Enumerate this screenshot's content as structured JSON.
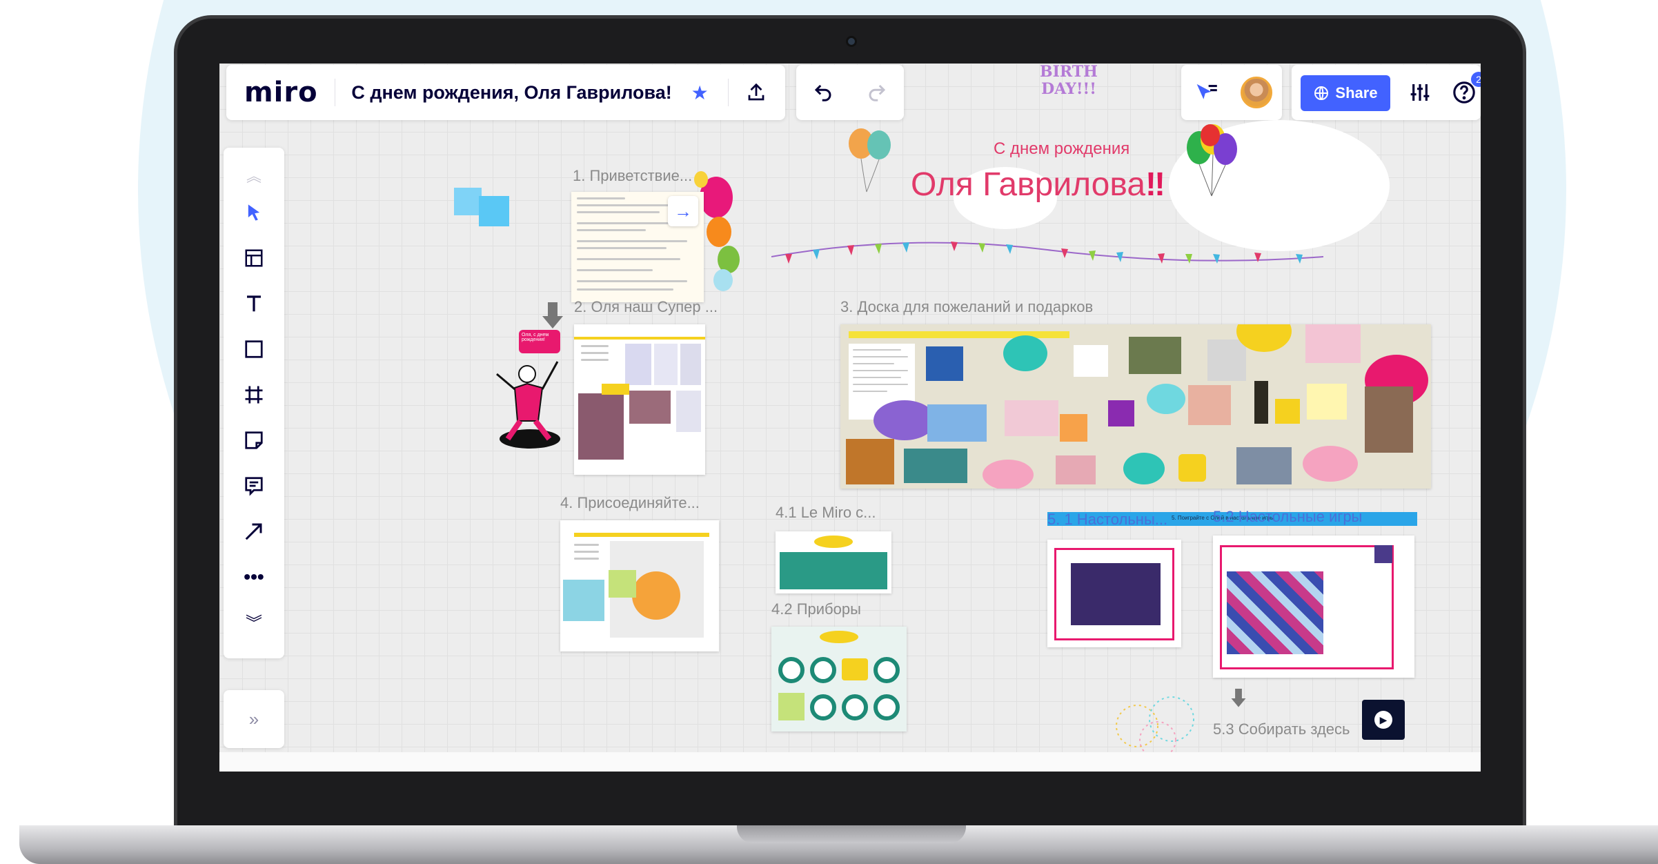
{
  "app": {
    "logo": "miro",
    "board_title": "С днем рождения, Оля Гаврилова!",
    "share_label": "Share",
    "notification_count": "2",
    "sticker_text": "BIRTH DAY!!!"
  },
  "toolbar": {
    "tools": [
      "collapse-up",
      "select",
      "templates",
      "text",
      "shape",
      "frame",
      "sticky-note",
      "comment",
      "pen-arrow",
      "more",
      "expand-down"
    ],
    "collapse_label": "»"
  },
  "canvas": {
    "greeting_small": "С днем рождения",
    "greeting_big": "Оля Гаврилова",
    "greeting_mark": "‼",
    "frames": {
      "f1": "1. Приветствие...",
      "f2": "2. Оля наш Супер ...",
      "f3": "3. Доска для пожеланий и подарков",
      "f4": "4. Присоединяйте...",
      "f41": "4.1 Le Miro c...",
      "f42": "4.2 Приборы",
      "f51": "5. 1 Настольны...",
      "f52": "5.2 Настольные игры",
      "f53": "5.3 Собирать здесь"
    },
    "speech_bubble_text": "Оля, с днем рождения!",
    "banner_strip_text": "5. Поиграйте с Олей в настольные игры"
  },
  "colors": {
    "accent": "#4262ff",
    "greeting": "#e13a6a",
    "frame_label": "#8a8a8a",
    "sticky_blue": "#5ac8f5"
  }
}
